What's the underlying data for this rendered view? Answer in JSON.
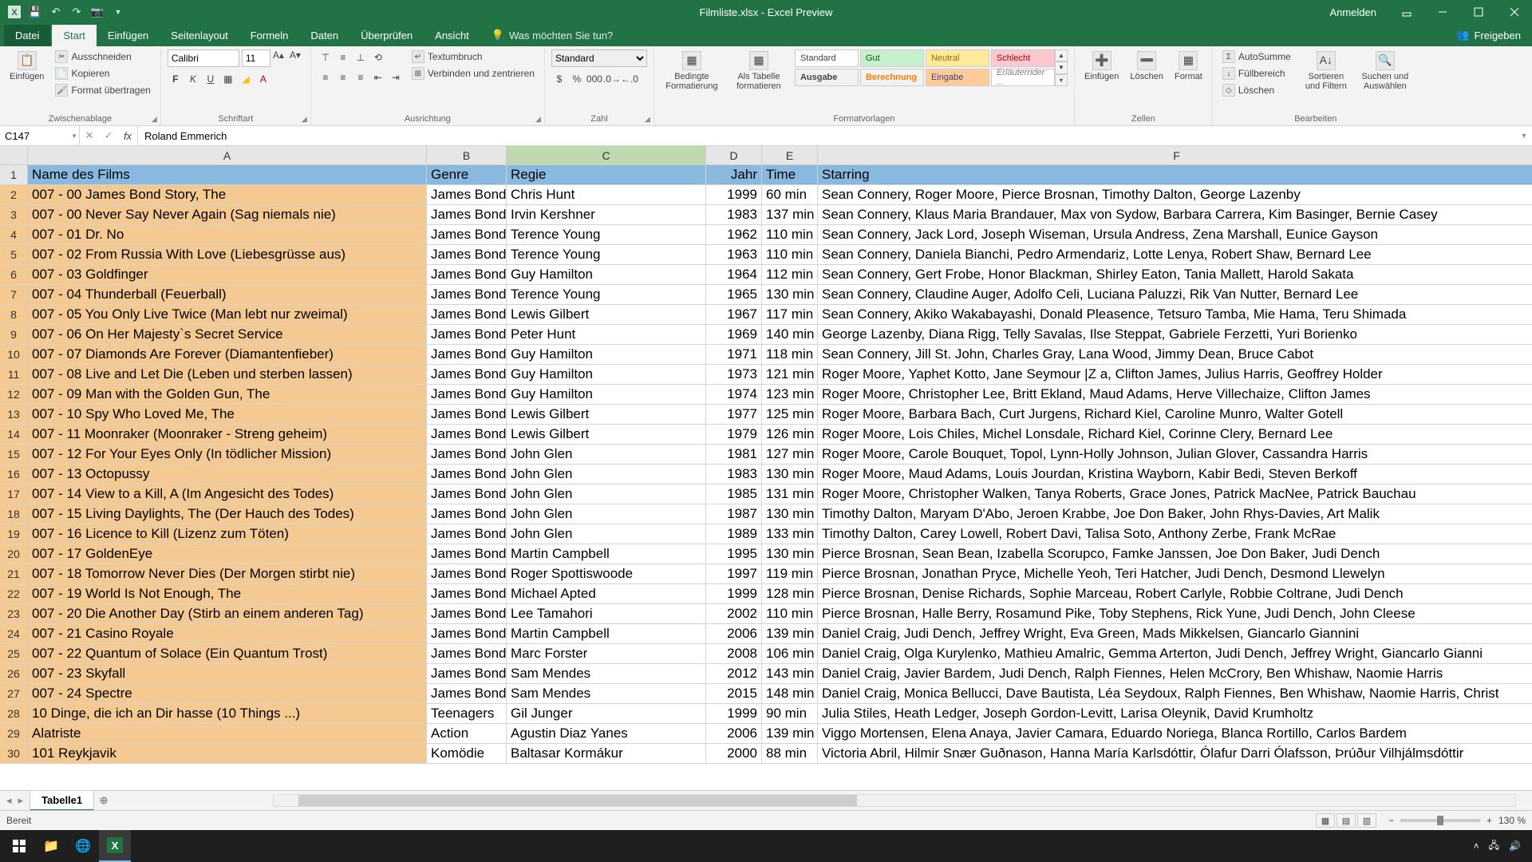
{
  "app": {
    "title": "Filmliste.xlsx - Excel Preview",
    "signin": "Anmelden"
  },
  "tabs": {
    "file": "Datei",
    "start": "Start",
    "einfugen": "Einfügen",
    "seitenlayout": "Seitenlayout",
    "formeln": "Formeln",
    "daten": "Daten",
    "uberprufen": "Überprüfen",
    "ansicht": "Ansicht",
    "tellme": "Was möchten Sie tun?",
    "freigeben": "Freigeben"
  },
  "ribbon": {
    "clipboard": {
      "paste": "Einfügen",
      "cut": "Ausschneiden",
      "copy": "Kopieren",
      "format_painter": "Format übertragen",
      "label": "Zwischenablage"
    },
    "font": {
      "name": "Calibri",
      "size": "11",
      "label": "Schriftart"
    },
    "alignment": {
      "wrap": "Textumbruch",
      "merge": "Verbinden und zentrieren",
      "label": "Ausrichtung"
    },
    "number": {
      "format": "Standard",
      "label": "Zahl"
    },
    "styles": {
      "conditional": "Bedingte Formatierung",
      "as_table": "Als Tabelle formatieren",
      "standard": "Standard",
      "gut": "Gut",
      "neutral": "Neutral",
      "schlecht": "Schlecht",
      "ausgabe": "Ausgabe",
      "berechnung": "Berechnung",
      "eingabe": "Eingabe",
      "erlauternd": "Erläuternder ...",
      "label": "Formatvorlagen"
    },
    "cells": {
      "insert": "Einfügen",
      "delete": "Löschen",
      "format": "Format",
      "label": "Zellen"
    },
    "editing": {
      "autosum": "AutoSumme",
      "fill": "Füllbereich",
      "clear": "Löschen",
      "sort": "Sortieren und Filtern",
      "find": "Suchen und Auswählen",
      "label": "Bearbeiten"
    }
  },
  "formula": {
    "cell_ref": "C147",
    "value": "Roland Emmerich"
  },
  "columns": [
    "A",
    "B",
    "C",
    "D",
    "E",
    "F"
  ],
  "headers": {
    "name": "Name des Films",
    "genre": "Genre",
    "regie": "Regie",
    "jahr": "Jahr",
    "time": "Time",
    "starring": "Starring"
  },
  "rows": [
    {
      "n": 2,
      "name": "007 - 00 James Bond Story, The",
      "genre": "James Bond",
      "regie": "Chris Hunt",
      "jahr": "1999",
      "time": "60 min",
      "star": "Sean Connery, Roger Moore, Pierce Brosnan, Timothy Dalton, George Lazenby"
    },
    {
      "n": 3,
      "name": "007 - 00 Never Say Never Again (Sag niemals nie)",
      "genre": "James Bond",
      "regie": "Irvin Kershner",
      "jahr": "1983",
      "time": "137 min",
      "star": "Sean Connery, Klaus Maria Brandauer, Max von Sydow, Barbara Carrera, Kim Basinger, Bernie Casey"
    },
    {
      "n": 4,
      "name": "007 - 01 Dr. No",
      "genre": "James Bond",
      "regie": "Terence Young",
      "jahr": "1962",
      "time": "110 min",
      "star": "Sean Connery, Jack Lord, Joseph Wiseman, Ursula Andress, Zena Marshall, Eunice Gayson"
    },
    {
      "n": 5,
      "name": "007 - 02 From Russia With Love (Liebesgrüsse aus)",
      "genre": "James Bond",
      "regie": "Terence Young",
      "jahr": "1963",
      "time": "110 min",
      "star": "Sean Connery, Daniela Bianchi, Pedro Armendariz, Lotte Lenya, Robert Shaw, Bernard Lee"
    },
    {
      "n": 6,
      "name": "007 - 03 Goldfinger",
      "genre": "James Bond",
      "regie": "Guy Hamilton",
      "jahr": "1964",
      "time": "112 min",
      "star": "Sean Connery, Gert Frobe, Honor Blackman, Shirley Eaton, Tania Mallett, Harold Sakata"
    },
    {
      "n": 7,
      "name": "007 - 04 Thunderball (Feuerball)",
      "genre": "James Bond",
      "regie": "Terence Young",
      "jahr": "1965",
      "time": "130 min",
      "star": "Sean Connery, Claudine Auger, Adolfo Celi, Luciana Paluzzi, Rik Van Nutter, Bernard Lee"
    },
    {
      "n": 8,
      "name": "007 - 05 You Only Live Twice (Man lebt nur zweimal)",
      "genre": "James Bond",
      "regie": "Lewis Gilbert",
      "jahr": "1967",
      "time": "117 min",
      "star": "Sean Connery, Akiko Wakabayashi, Donald Pleasence, Tetsuro Tamba, Mie Hama, Teru Shimada"
    },
    {
      "n": 9,
      "name": "007 - 06 On Her Majesty`s Secret Service",
      "genre": "James Bond",
      "regie": "Peter Hunt",
      "jahr": "1969",
      "time": "140 min",
      "star": "George Lazenby, Diana Rigg, Telly Savalas, Ilse Steppat, Gabriele Ferzetti, Yuri Borienko"
    },
    {
      "n": 10,
      "name": "007 - 07 Diamonds Are Forever (Diamantenfieber)",
      "genre": "James Bond",
      "regie": "Guy Hamilton",
      "jahr": "1971",
      "time": "118 min",
      "star": "Sean Connery, Jill St. John, Charles Gray, Lana Wood, Jimmy Dean, Bruce Cabot"
    },
    {
      "n": 11,
      "name": "007 - 08 Live and Let Die (Leben und sterben lassen)",
      "genre": "James Bond",
      "regie": "Guy Hamilton",
      "jahr": "1973",
      "time": "121 min",
      "star": "Roger Moore, Yaphet Kotto, Jane Seymour |Z a, Clifton James, Julius Harris, Geoffrey Holder"
    },
    {
      "n": 12,
      "name": "007 - 09 Man with the Golden Gun, The",
      "genre": "James Bond",
      "regie": "Guy Hamilton",
      "jahr": "1974",
      "time": "123 min",
      "star": "Roger Moore, Christopher Lee, Britt Ekland, Maud Adams, Herve Villechaize, Clifton James"
    },
    {
      "n": 13,
      "name": "007 - 10 Spy Who Loved Me, The",
      "genre": "James Bond",
      "regie": "Lewis Gilbert",
      "jahr": "1977",
      "time": "125 min",
      "star": "Roger Moore, Barbara Bach, Curt Jurgens, Richard Kiel, Caroline Munro, Walter Gotell"
    },
    {
      "n": 14,
      "name": "007 - 11 Moonraker (Moonraker - Streng geheim)",
      "genre": "James Bond",
      "regie": "Lewis Gilbert",
      "jahr": "1979",
      "time": "126 min",
      "star": "Roger Moore, Lois Chiles, Michel Lonsdale, Richard Kiel, Corinne Clery, Bernard Lee"
    },
    {
      "n": 15,
      "name": "007 - 12 For Your Eyes Only (In tödlicher Mission)",
      "genre": "James Bond",
      "regie": "John Glen",
      "jahr": "1981",
      "time": "127 min",
      "star": "Roger Moore, Carole Bouquet, Topol, Lynn-Holly Johnson, Julian Glover, Cassandra Harris"
    },
    {
      "n": 16,
      "name": "007 - 13 Octopussy",
      "genre": "James Bond",
      "regie": "John Glen",
      "jahr": "1983",
      "time": "130 min",
      "star": "Roger Moore, Maud Adams, Louis Jourdan, Kristina Wayborn, Kabir Bedi, Steven Berkoff"
    },
    {
      "n": 17,
      "name": "007 - 14 View to a Kill, A (Im Angesicht des Todes)",
      "genre": "James Bond",
      "regie": "John Glen",
      "jahr": "1985",
      "time": "131 min",
      "star": "Roger Moore, Christopher Walken, Tanya Roberts, Grace Jones, Patrick MacNee, Patrick Bauchau"
    },
    {
      "n": 18,
      "name": "007 - 15 Living Daylights, The (Der Hauch des Todes)",
      "genre": "James Bond",
      "regie": "John Glen",
      "jahr": "1987",
      "time": "130 min",
      "star": "Timothy Dalton, Maryam D'Abo, Jeroen Krabbe, Joe Don Baker, John Rhys-Davies, Art Malik"
    },
    {
      "n": 19,
      "name": "007 - 16 Licence to Kill (Lizenz zum Töten)",
      "genre": "James Bond",
      "regie": "John Glen",
      "jahr": "1989",
      "time": "133 min",
      "star": "Timothy Dalton, Carey Lowell, Robert Davi, Talisa Soto, Anthony Zerbe, Frank McRae"
    },
    {
      "n": 20,
      "name": "007 - 17 GoldenEye",
      "genre": "James Bond",
      "regie": "Martin Campbell",
      "jahr": "1995",
      "time": "130 min",
      "star": "Pierce Brosnan, Sean Bean, Izabella Scorupco, Famke Janssen, Joe Don Baker, Judi Dench"
    },
    {
      "n": 21,
      "name": "007 - 18 Tomorrow Never Dies (Der Morgen stirbt nie)",
      "genre": "James Bond",
      "regie": "Roger Spottiswoode",
      "jahr": "1997",
      "time": "119 min",
      "star": "Pierce Brosnan, Jonathan Pryce, Michelle Yeoh, Teri Hatcher, Judi Dench, Desmond Llewelyn"
    },
    {
      "n": 22,
      "name": "007 - 19 World Is Not Enough, The",
      "genre": "James Bond",
      "regie": "Michael Apted",
      "jahr": "1999",
      "time": "128 min",
      "star": "Pierce Brosnan, Denise Richards, Sophie Marceau, Robert Carlyle, Robbie Coltrane, Judi Dench"
    },
    {
      "n": 23,
      "name": "007 - 20 Die Another Day (Stirb an einem anderen Tag)",
      "genre": "James Bond",
      "regie": "Lee Tamahori",
      "jahr": "2002",
      "time": "110 min",
      "star": "Pierce Brosnan, Halle Berry, Rosamund Pike, Toby Stephens, Rick Yune, Judi Dench, John Cleese"
    },
    {
      "n": 24,
      "name": "007 - 21 Casino Royale",
      "genre": "James Bond",
      "regie": "Martin Campbell",
      "jahr": "2006",
      "time": "139 min",
      "star": "Daniel Craig, Judi Dench, Jeffrey Wright, Eva Green, Mads Mikkelsen, Giancarlo Giannini"
    },
    {
      "n": 25,
      "name": "007 - 22 Quantum of Solace (Ein Quantum Trost)",
      "genre": "James Bond",
      "regie": "Marc Forster",
      "jahr": "2008",
      "time": "106 min",
      "star": "Daniel Craig, Olga Kurylenko, Mathieu Amalric, Gemma Arterton, Judi Dench, Jeffrey Wright, Giancarlo Gianni"
    },
    {
      "n": 26,
      "name": "007 - 23 Skyfall",
      "genre": "James Bond",
      "regie": "Sam Mendes",
      "jahr": "2012",
      "time": "143 min",
      "star": "Daniel Craig, Javier Bardem, Judi Dench, Ralph Fiennes, Helen McCrory, Ben Whishaw, Naomie Harris"
    },
    {
      "n": 27,
      "name": "007 - 24 Spectre",
      "genre": "James Bond",
      "regie": "Sam Mendes",
      "jahr": "2015",
      "time": "148 min",
      "star": "Daniel Craig, Monica Bellucci, Dave Bautista, Léa Seydoux, Ralph Fiennes, Ben Whishaw, Naomie Harris, Christ"
    },
    {
      "n": 28,
      "name": "10 Dinge, die ich an Dir hasse (10 Things ...)",
      "genre": "Teenagers",
      "regie": "Gil Junger",
      "jahr": "1999",
      "time": "90 min",
      "star": "Julia Stiles, Heath Ledger, Joseph Gordon-Levitt, Larisa Oleynik, David Krumholtz"
    },
    {
      "n": 29,
      "name": "Alatriste",
      "genre": "Action",
      "regie": "Agustin Diaz Yanes",
      "jahr": "2006",
      "time": "139 min",
      "star": "Viggo Mortensen, Elena Anaya, Javier Camara, Eduardo Noriega, Blanca Rortillo, Carlos Bardem"
    },
    {
      "n": 30,
      "name": "101 Reykjavik",
      "genre": "Komödie",
      "regie": "Baltasar Kormákur",
      "jahr": "2000",
      "time": "88 min",
      "star": "Victoria Abril, Hilmir Snær Guðnason, Hanna María Karlsdóttir, Ólafur Darri Ólafsson, Þrúður Vilhjálmsdóttir"
    }
  ],
  "sheet": {
    "name": "Tabelle1"
  },
  "status": {
    "ready": "Bereit",
    "zoom": "130 %"
  }
}
